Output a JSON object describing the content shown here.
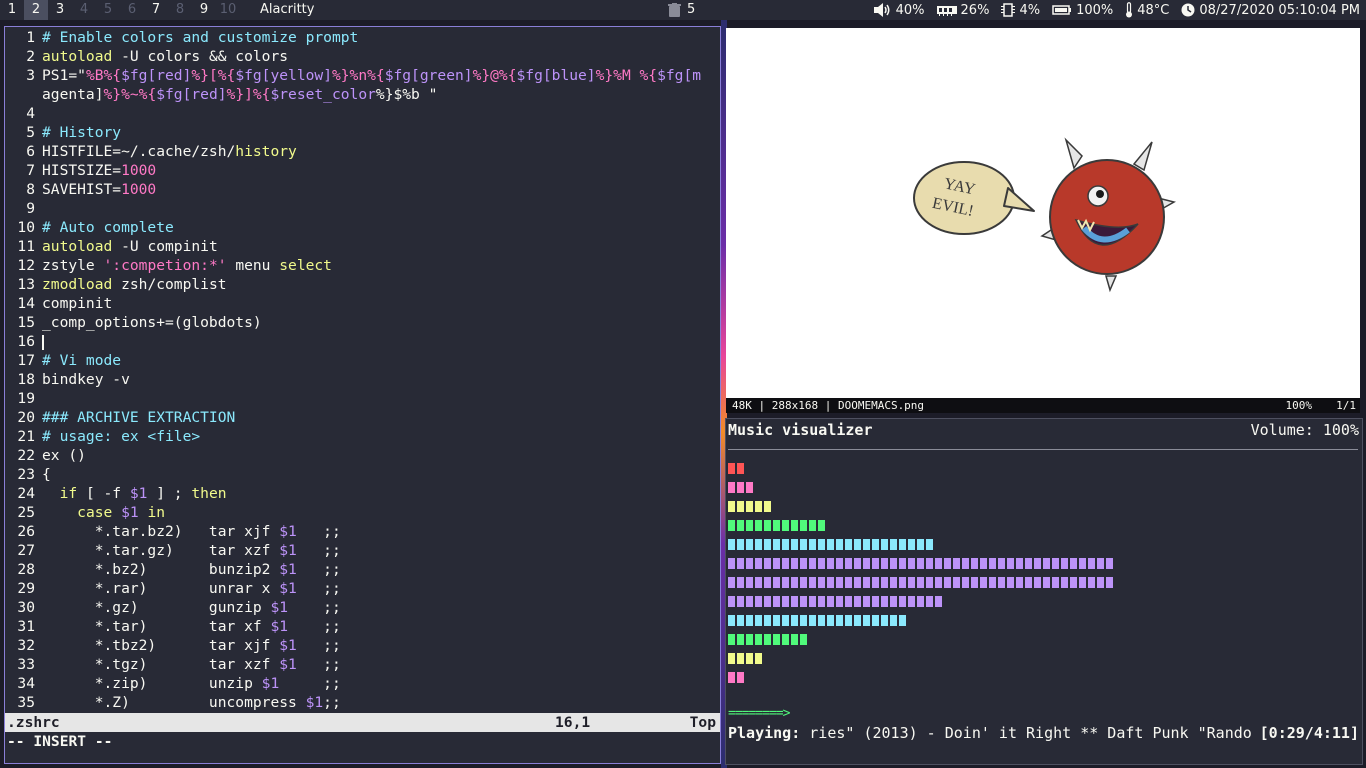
{
  "topbar": {
    "workspaces": [
      "1",
      "2",
      "3",
      "4",
      "5",
      "6",
      "7",
      "8",
      "9",
      "10"
    ],
    "window_title": "Alacritty",
    "trash_count": "5",
    "volume": "40%",
    "memory": "26%",
    "cpu": "4%",
    "battery": "100%",
    "temperature": "48°C",
    "datetime": "08/27/2020 05:10:04 PM"
  },
  "editor": {
    "lines": [
      {
        "n": "1",
        "t": "# Enable colors and customize prompt"
      },
      {
        "n": "2",
        "t": "autoload -U colors && colors"
      },
      {
        "n": "3",
        "t": "PS1=\"%B%{$fg[red]%}[%{$fg[yellow]%}%n%{$fg[green]%}@%{$fg[blue]%}%M %{$fg[m"
      },
      {
        "n": "",
        "t": "agenta]%}%~%{$fg[red]%}]%{$reset_color%}$%b \""
      },
      {
        "n": "4",
        "t": ""
      },
      {
        "n": "5",
        "t": "# History"
      },
      {
        "n": "6",
        "t": "HISTFILE=~/.cache/zsh/history"
      },
      {
        "n": "7",
        "t": "HISTSIZE=1000"
      },
      {
        "n": "8",
        "t": "SAVEHIST=1000"
      },
      {
        "n": "9",
        "t": ""
      },
      {
        "n": "10",
        "t": "# Auto complete"
      },
      {
        "n": "11",
        "t": "autoload -U compinit"
      },
      {
        "n": "12",
        "t": "zstyle ':competion:*' menu select"
      },
      {
        "n": "13",
        "t": "zmodload zsh/complist"
      },
      {
        "n": "14",
        "t": "compinit"
      },
      {
        "n": "15",
        "t": "_comp_options+=(globdots)"
      },
      {
        "n": "16",
        "t": ""
      },
      {
        "n": "17",
        "t": "# Vi mode"
      },
      {
        "n": "18",
        "t": "bindkey -v"
      },
      {
        "n": "19",
        "t": ""
      },
      {
        "n": "20",
        "t": "### ARCHIVE EXTRACTION"
      },
      {
        "n": "21",
        "t": "# usage: ex <file>"
      },
      {
        "n": "22",
        "t": "ex ()"
      },
      {
        "n": "23",
        "t": "{"
      },
      {
        "n": "24",
        "t": "  if [ -f $1 ] ; then"
      },
      {
        "n": "25",
        "t": "    case $1 in"
      },
      {
        "n": "26",
        "t": "      *.tar.bz2)   tar xjf $1   ;;"
      },
      {
        "n": "27",
        "t": "      *.tar.gz)    tar xzf $1   ;;"
      },
      {
        "n": "28",
        "t": "      *.bz2)       bunzip2 $1   ;;"
      },
      {
        "n": "29",
        "t": "      *.rar)       unrar x $1   ;;"
      },
      {
        "n": "30",
        "t": "      *.gz)        gunzip $1    ;;"
      },
      {
        "n": "31",
        "t": "      *.tar)       tar xf $1    ;;"
      },
      {
        "n": "32",
        "t": "      *.tbz2)      tar xjf $1   ;;"
      },
      {
        "n": "33",
        "t": "      *.tgz)       tar xzf $1   ;;"
      },
      {
        "n": "34",
        "t": "      *.zip)       unzip $1     ;;"
      },
      {
        "n": "35",
        "t": "      *.Z)         uncompress $1;;"
      }
    ],
    "file_name": ".zshrc",
    "cursor_position": "16,1",
    "scroll_position": "Top",
    "mode": "-- INSERT --"
  },
  "viewer": {
    "file_info": "48K | 288x168 | DOOMEMACS.png",
    "zoom": "100%",
    "page": "1/1",
    "bubble_text_line1": "YAY",
    "bubble_text_line2": "EVIL!"
  },
  "visualizer": {
    "title": "Music visualizer",
    "volume": "Volume: 100%",
    "progress": "========>",
    "playing_label": "Playing:",
    "track": " ries\" (2013) - Doin' it Right ** Daft Punk \"Rando",
    "time": "[0:29/4:11]",
    "rows": [
      {
        "color": "#ff5555",
        "count": 2
      },
      {
        "color": "#ff79c6",
        "count": 3
      },
      {
        "color": "#f1fa8c",
        "count": 5
      },
      {
        "color": "#50fa7b",
        "count": 11
      },
      {
        "color": "#8be9fd",
        "count": 23
      },
      {
        "color": "#bd93f9",
        "count": 43
      },
      {
        "color": "#bd93f9",
        "count": 43
      },
      {
        "color": "#bd93f9",
        "count": 24
      },
      {
        "color": "#8be9fd",
        "count": 20
      },
      {
        "color": "#50fa7b",
        "count": 9
      },
      {
        "color": "#f1fa8c",
        "count": 4
      },
      {
        "color": "#ff79c6",
        "count": 2
      }
    ]
  }
}
